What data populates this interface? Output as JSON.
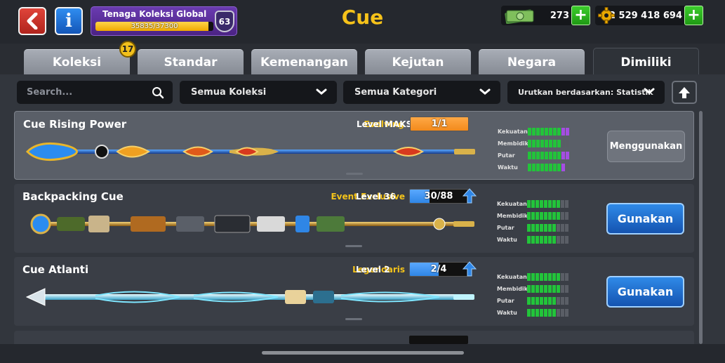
{
  "header": {
    "title": "Cue",
    "power": {
      "title": "Tenaga Koleksi Global",
      "progress": "35835/37300",
      "progress_fraction": 0.96,
      "level": "63"
    },
    "cash": "273",
    "coins": "2 529 418 694",
    "icons": {
      "back": "chevron-left-icon",
      "info": "info-icon",
      "cash": "cash-icon",
      "coins": "gear-coin-icon",
      "add": "plus-icon"
    }
  },
  "tabs": [
    {
      "label": "Koleksi",
      "badge": "17"
    },
    {
      "label": "Standar"
    },
    {
      "label": "Kemenangan"
    },
    {
      "label": "Kejutan"
    },
    {
      "label": "Negara"
    },
    {
      "label": "Dimiliki",
      "active": true
    }
  ],
  "filters": {
    "search_placeholder": "Search...",
    "collection": "Semua Koleksi",
    "category": "Semua Kategori",
    "sort": "Urutkan berdasarkan: Statistik"
  },
  "stat_labels": [
    "Kekuatan",
    "Membidik",
    "Putar",
    "Waktu"
  ],
  "colors": {
    "title": "#f6c21a",
    "rarity": "#f4c31a",
    "stat_green": "#22c43a",
    "stat_purple": "#a44ee2",
    "level_orange": "#f28a1c",
    "level_blue": "#2f86e6"
  },
  "cues": [
    {
      "name": "Cue Rising Power",
      "rarity": "Evolving",
      "level": "Level MAKS",
      "progress": "1/1",
      "progress_fraction": 1.0,
      "bar_color": "orange",
      "stats": [
        [
          8,
          2
        ],
        [
          8,
          0
        ],
        [
          8,
          2
        ],
        [
          8,
          1
        ]
      ],
      "action": "Menggunakan",
      "in_use": true
    },
    {
      "name": "Backpacking Cue",
      "rarity": "Event Exclusive",
      "level": "Level 36",
      "progress": "30/88",
      "progress_fraction": 0.34,
      "bar_color": "blue",
      "stats": [
        [
          8,
          0
        ],
        [
          8,
          0
        ],
        [
          7,
          0
        ],
        [
          7,
          0
        ]
      ],
      "action": "Gunakan",
      "in_use": false
    },
    {
      "name": "Cue Atlanti",
      "rarity": "Legendaris",
      "level": "Level 2",
      "progress": "2/4",
      "progress_fraction": 0.5,
      "bar_color": "blue",
      "stats": [
        [
          8,
          0
        ],
        [
          8,
          0
        ],
        [
          7,
          0
        ],
        [
          7,
          0
        ]
      ],
      "action": "Gunakan",
      "in_use": false
    }
  ]
}
